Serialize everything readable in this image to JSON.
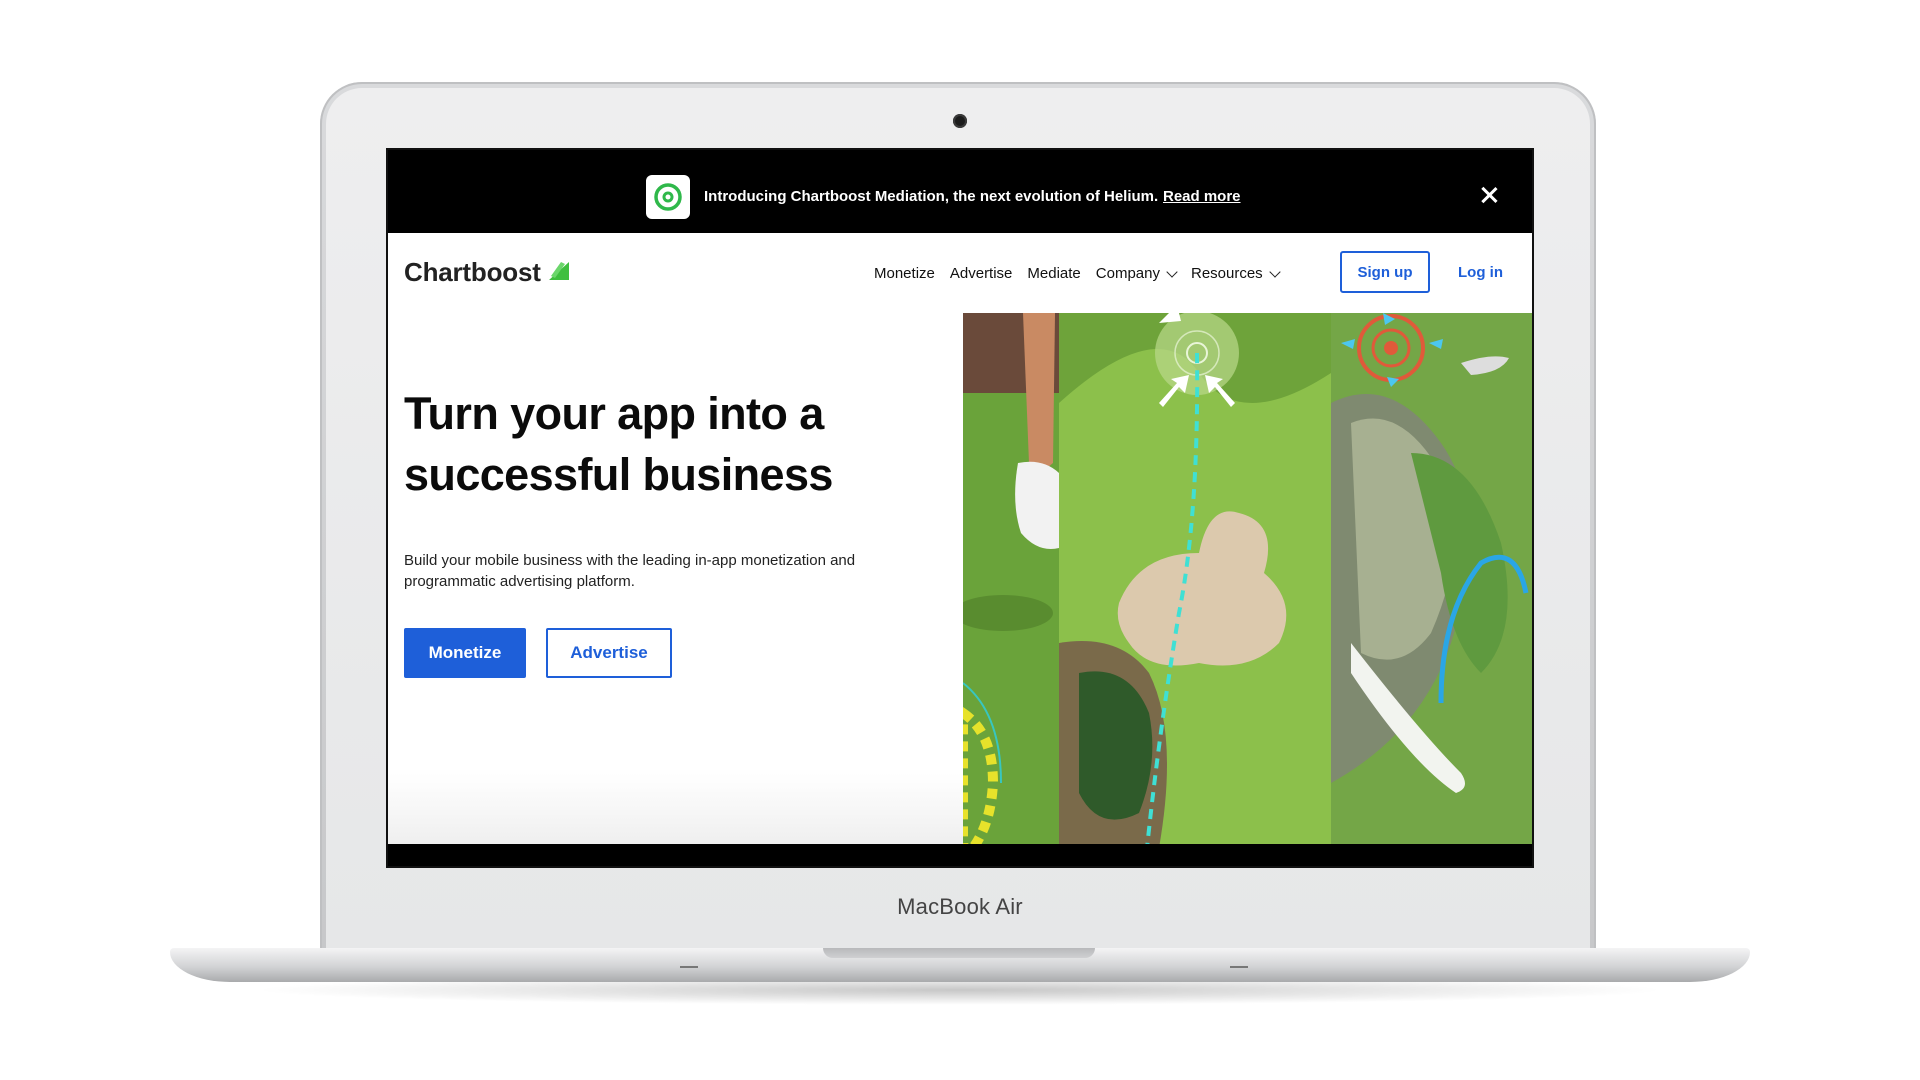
{
  "device": {
    "model_label": "MacBook Air"
  },
  "announcement": {
    "text": "Introducing Chartboost Mediation, the next evolution of Helium.",
    "link_label": "Read more",
    "logo_icon": "chartboost-mediation-logo-icon",
    "close_icon": "close-icon"
  },
  "nav": {
    "brand": "Chartboost",
    "items": [
      {
        "label": "Monetize"
      },
      {
        "label": "Advertise"
      },
      {
        "label": "Mediate"
      },
      {
        "label": "Company",
        "has_dropdown": true
      },
      {
        "label": "Resources",
        "has_dropdown": true
      }
    ],
    "signup_label": "Sign up",
    "login_label": "Log in"
  },
  "hero": {
    "title_line1": "Turn your app into a",
    "title_line2": "successful business",
    "subtitle": "Build your mobile business with the leading in-app monetization and programmatic advertising platform.",
    "primary_cta": "Monetize",
    "secondary_cta": "Advertise"
  },
  "colors": {
    "brand_blue": "#1e5fd9",
    "brand_green": "#3fbf3f",
    "announcement_bg": "#000000"
  }
}
